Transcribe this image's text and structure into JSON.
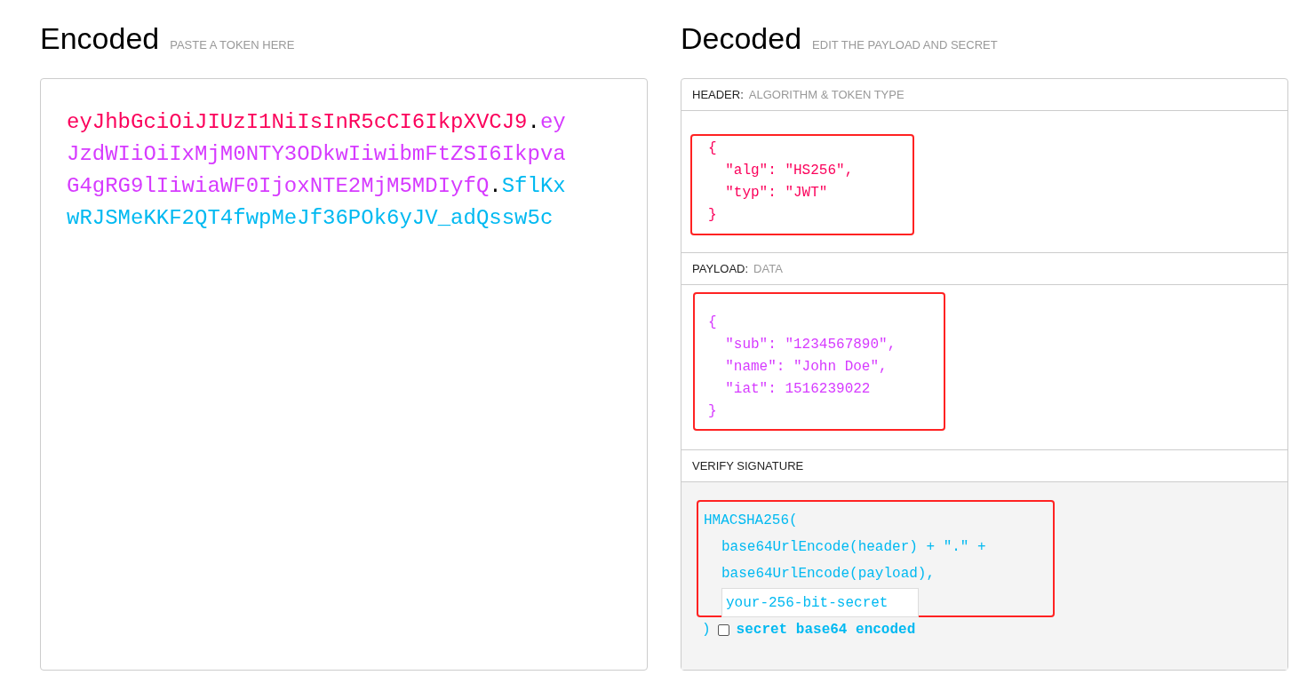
{
  "encoded": {
    "title": "Encoded",
    "subtitle": "PASTE A TOKEN HERE",
    "lines": [
      [
        {
          "kind": "header",
          "text": "eyJhbGciOiJIUzI1NiIsInR5cCI6IkpXVCJ9"
        },
        {
          "kind": "dot",
          "text": "."
        },
        {
          "kind": "payload",
          "text": "ey"
        }
      ],
      [
        {
          "kind": "payload",
          "text": "JzdWIiOiIxMjM0NTY3ODkwIiwibmFtZSI6Ikpva"
        }
      ],
      [
        {
          "kind": "payload",
          "text": "G4gRG9lIiwiaWF0IjoxNTE2MjM5MDIyfQ"
        },
        {
          "kind": "dot",
          "text": "."
        },
        {
          "kind": "signature",
          "text": "SflKx"
        }
      ],
      [
        {
          "kind": "signature",
          "text": "wRJSMeKKF2QT4fwpMeJf36POk6yJV_adQssw5c"
        }
      ]
    ]
  },
  "decoded": {
    "title": "Decoded",
    "subtitle": "EDIT THE PAYLOAD AND SECRET",
    "header": {
      "label": "HEADER:",
      "sublabel": "ALGORITHM & TOKEN TYPE",
      "lines": [
        "{",
        "  \"alg\": \"HS256\",",
        "  \"typ\": \"JWT\"",
        "}"
      ]
    },
    "payload": {
      "label": "PAYLOAD:",
      "sublabel": "DATA",
      "lines": [
        "{",
        "  \"sub\": \"1234567890\",",
        "  \"name\": \"John Doe\",",
        "  \"iat\": 1516239022",
        "}"
      ]
    },
    "signature": {
      "label": "VERIFY SIGNATURE",
      "function": "HMACSHA256(",
      "args": [
        "base64UrlEncode(header) + \".\" +",
        "base64UrlEncode(payload),"
      ],
      "secret": "your-256-bit-secret",
      "close": ")",
      "base64_checkbox": {
        "label": "secret base64 encoded",
        "checked": false
      }
    }
  }
}
